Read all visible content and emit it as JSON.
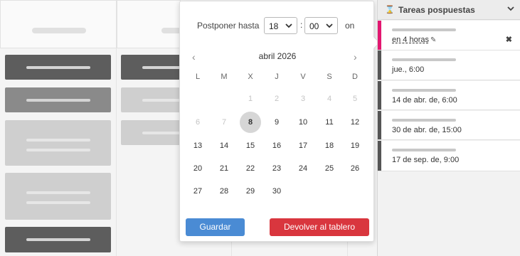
{
  "postpone": {
    "label": "Postponer hasta",
    "hour": "18",
    "minute": "00",
    "colon": ":",
    "suffix": "on"
  },
  "calendar": {
    "month_label": "abril 2026",
    "prev_icon": "‹",
    "next_icon": "›",
    "weekdays": [
      "L",
      "M",
      "X",
      "J",
      "V",
      "S",
      "D"
    ],
    "rows": [
      [
        "",
        "",
        "1",
        "2",
        "3",
        "4",
        "5"
      ],
      [
        "6",
        "7",
        "8",
        "9",
        "10",
        "11",
        "12"
      ],
      [
        "13",
        "14",
        "15",
        "16",
        "17",
        "18",
        "19"
      ],
      [
        "20",
        "21",
        "22",
        "23",
        "24",
        "25",
        "26"
      ],
      [
        "27",
        "28",
        "29",
        "30",
        "",
        "",
        ""
      ]
    ],
    "selected": "8"
  },
  "buttons": {
    "save": "Guardar",
    "return": "Devolver al tablero"
  },
  "panel": {
    "title": "Tareas pospuestas",
    "hourglass_icon": "⌛",
    "chevron_icon": "⌄",
    "tasks": [
      {
        "when": "en 4 horas",
        "active": true
      },
      {
        "when": "jue., 6:00"
      },
      {
        "when": "14 de abr. de, 6:00"
      },
      {
        "when": "30 de abr. de, 15:00"
      },
      {
        "when": "17 de sep. de, 9:00"
      }
    ],
    "pencil_icon": "✎",
    "close_icon": "✖"
  },
  "colors": {
    "accent_pink": "#e21770",
    "save_blue": "#4a8bd4",
    "return_red": "#d9363e"
  }
}
